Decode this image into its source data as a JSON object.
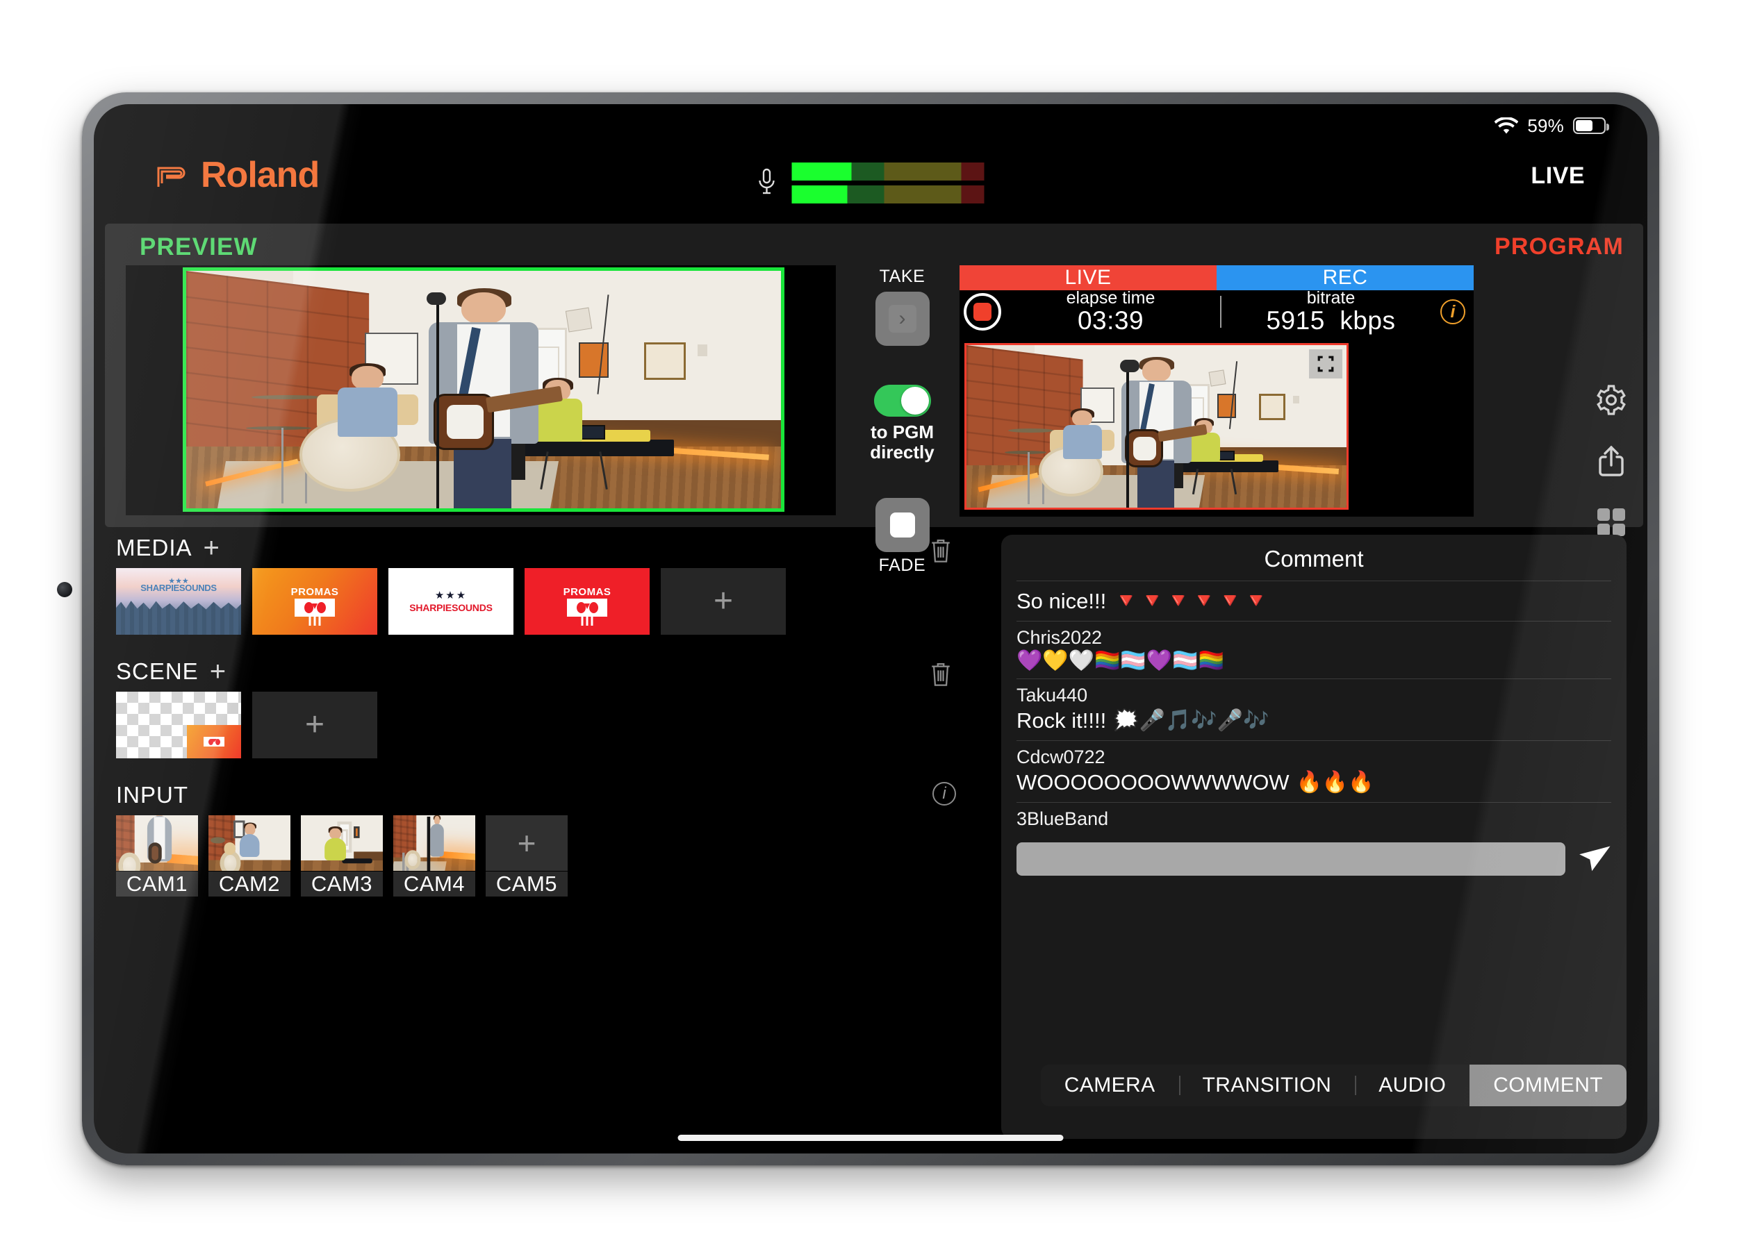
{
  "status_bar": {
    "battery_percent": "59%",
    "wifi_icon": "wifi-icon",
    "battery_icon": "battery-icon"
  },
  "header": {
    "brand": "Roland",
    "brand_color": "#F26322",
    "mic_icon": "microphone-icon",
    "live_label": "LIVE"
  },
  "workspace": {
    "preview_label": "PREVIEW",
    "preview_color": "#45d45f",
    "program_label": "PROGRAM",
    "program_color": "#f0402b"
  },
  "switcher": {
    "take_label": "TAKE",
    "take_icon": "chevron-right-icon",
    "toggle_label_line1": "to PGM",
    "toggle_label_line2": "directly",
    "toggle_state": "on",
    "toggle_color": "#34c759",
    "fade_label": "FADE",
    "fade_icon": "stop-square-icon"
  },
  "program": {
    "tab_live": "LIVE",
    "tab_rec": "REC",
    "live_color": "#f04437",
    "rec_color": "#2b94f0",
    "record_icon": "record-button-icon",
    "elapse_key": "elapse time",
    "elapse_value": "03:39",
    "bitrate_key": "bitrate",
    "bitrate_value": "5915",
    "bitrate_unit": "kbps",
    "info_icon": "info-circle-icon",
    "fullscreen_icon": "fullscreen-expand-icon"
  },
  "side_icons": [
    {
      "name": "gear-icon",
      "label": "Settings"
    },
    {
      "name": "share-icon",
      "label": "Share"
    },
    {
      "name": "grid-icon",
      "label": "Layout"
    }
  ],
  "media": {
    "title": "MEDIA",
    "add_icon": "plus-icon",
    "trash_icon": "trash-icon",
    "items": [
      {
        "type": "forest",
        "caption": "SHARPIESOUNDS",
        "stars": "★★★"
      },
      {
        "type": "promas-orange",
        "caption": "PROMAS"
      },
      {
        "type": "sharpie-white",
        "caption": "SHARPIESOUNDS",
        "stars": "★★★"
      },
      {
        "type": "promas-red",
        "caption": "PROMAS"
      }
    ],
    "add_tile_icon": "plus-icon"
  },
  "scene": {
    "title": "SCENE",
    "add_icon": "plus-icon",
    "trash_icon": "trash-icon",
    "items": [
      {
        "type": "transparent-with-logo",
        "logo": "PROMAS"
      }
    ],
    "add_tile_icon": "plus-icon"
  },
  "input": {
    "title": "INPUT",
    "info_icon": "info-circle-icon",
    "cameras": [
      {
        "label": "CAM1",
        "selected": true,
        "empty": false
      },
      {
        "label": "CAM2",
        "selected": false,
        "empty": false
      },
      {
        "label": "CAM3",
        "selected": false,
        "empty": false
      },
      {
        "label": "CAM4",
        "selected": false,
        "empty": false
      },
      {
        "label": "CAM5",
        "selected": false,
        "empty": true,
        "add_icon": "plus-icon"
      }
    ]
  },
  "comments": {
    "title": "Comment",
    "rows": [
      {
        "user": "",
        "text": "So nice!!!",
        "emojis": "🔻🔻🔻🔻🔻🔻"
      },
      {
        "user": "Chris2022",
        "text": "",
        "emojis": "💜💛🤍🏳️‍🌈🏳️‍⚧️💜🏳️‍⚧️🏳️‍🌈"
      },
      {
        "user": "Taku440",
        "text": "Rock it!!!!",
        "emojis": "🗯️🎤🎵🎶🎤🎶"
      },
      {
        "user": "Cdcw0722",
        "text": "WOOOOOOOOWWWWOW",
        "emojis": "🔥🔥🔥"
      },
      {
        "user": "3BlueBand",
        "text": "",
        "emojis": ""
      }
    ],
    "input_value": "",
    "input_placeholder": "",
    "send_icon": "send-paper-plane-icon"
  },
  "tabs": [
    {
      "label": "CAMERA",
      "active": false
    },
    {
      "label": "TRANSITION",
      "active": false
    },
    {
      "label": "AUDIO",
      "active": false
    },
    {
      "label": "COMMENT",
      "active": true
    }
  ],
  "audio_meter": {
    "segments": [
      {
        "color": "#1aff2e",
        "width": "31%"
      },
      {
        "color": "#1c5a22",
        "width": "17%"
      },
      {
        "color": "#5d5a19",
        "width": "40%"
      },
      {
        "color": "#5c1414",
        "width": "12%"
      }
    ]
  }
}
